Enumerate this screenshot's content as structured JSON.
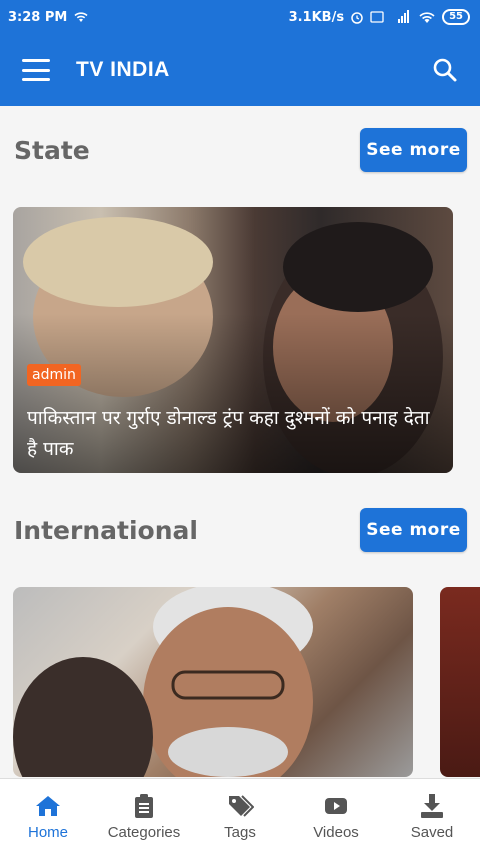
{
  "status_bar": {
    "time": "3:28 PM",
    "speed": "3.1KB/s",
    "battery": "55"
  },
  "app_bar": {
    "title": "TV INDIA",
    "menu_icon": "hamburger-menu-icon",
    "search_icon": "search-icon"
  },
  "sections": [
    {
      "title": "State",
      "see_more": "See more",
      "card": {
        "badge": "admin",
        "headline": "पाकिस्तान पर गुर्राए डोनाल्ड ट्रंप कहा दुश्मनों को पनाह देता है पाक"
      }
    },
    {
      "title": "International",
      "see_more": "See more"
    }
  ],
  "bottom_nav": [
    {
      "label": "Home",
      "icon": "home-icon",
      "active": true
    },
    {
      "label": "Categories",
      "icon": "clipboard-list-icon",
      "active": false
    },
    {
      "label": "Tags",
      "icon": "tags-icon",
      "active": false
    },
    {
      "label": "Videos",
      "icon": "play-video-icon",
      "active": false
    },
    {
      "label": "Saved",
      "icon": "download-icon",
      "active": false
    }
  ],
  "colors": {
    "primary": "#1e73d8",
    "badge": "#f26522"
  }
}
